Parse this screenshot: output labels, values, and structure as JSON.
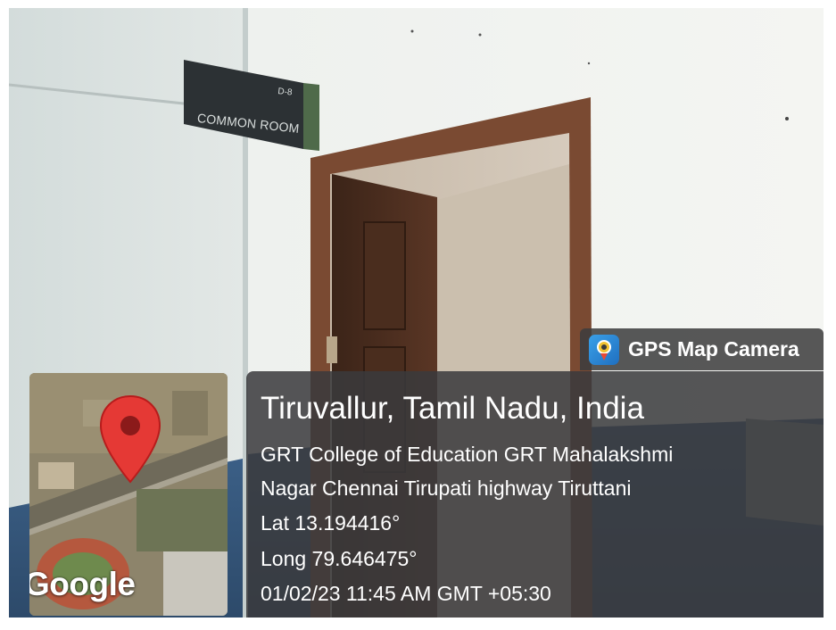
{
  "photo": {
    "description_free": true,
    "sign": {
      "code": "D-8",
      "label": "COMMON ROOM"
    }
  },
  "stamp": {
    "app_name": "GPS Map Camera",
    "app_icon": "gps-camera-icon",
    "place_title": "Tiruvallur, Tamil Nadu, India",
    "address_line_1": "GRT College of Education GRT Mahalakshmi",
    "address_line_2": "Nagar Chennai Tirupati highway Tiruttani",
    "latitude": "Lat 13.194416°",
    "longitude": "Long 79.646475°",
    "datetime": "01/02/23 11:45 AM GMT +05:30",
    "map": {
      "logo": "Google",
      "pin_icon": "map-pin-icon",
      "pin_color": "#e53935"
    }
  },
  "colors": {
    "panel": "#3a3a3c",
    "text": "#ffffff",
    "wall": "#e4e8e4",
    "door_frame": "#7a4a32"
  }
}
